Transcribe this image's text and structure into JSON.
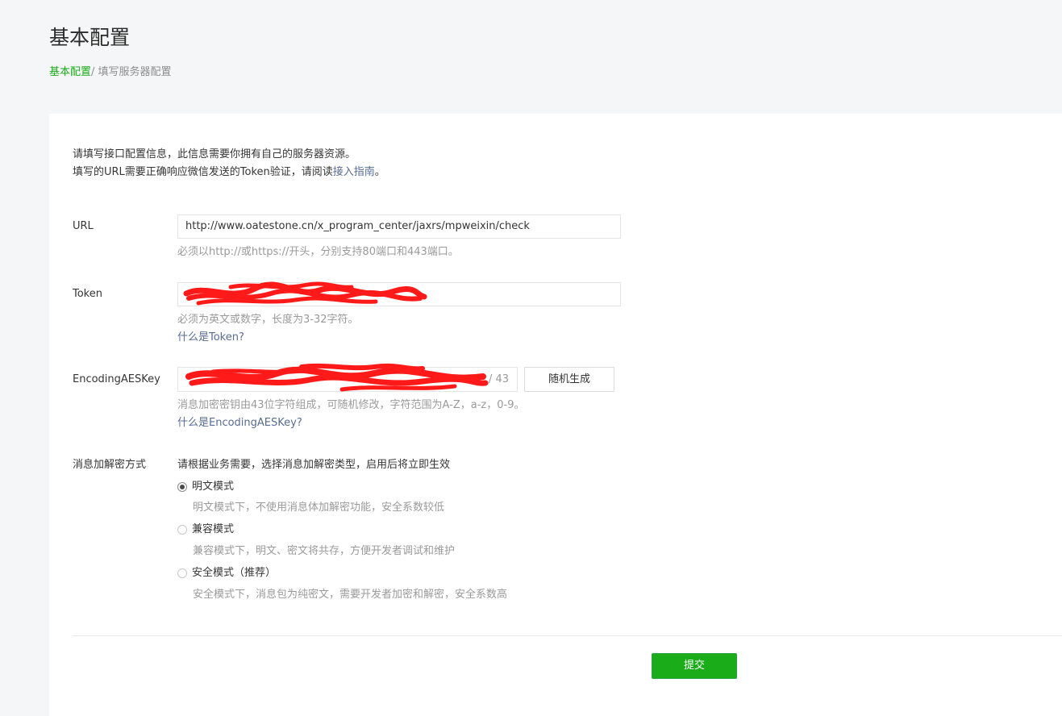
{
  "header": {
    "title": "基本配置",
    "breadcrumb": {
      "link": "基本配置",
      "separator": "/ ",
      "current": "填写服务器配置"
    }
  },
  "intro": {
    "line1": "请填写接口配置信息，此信息需要你拥有自己的服务器资源。",
    "line2_prefix": "填写的URL需要正确响应微信发送的Token验证，请阅读",
    "line2_link": "接入指南",
    "line2_suffix": "。"
  },
  "form": {
    "url": {
      "label": "URL",
      "value": "http://www.oatestone.cn/x_program_center/jaxrs/mpweixin/check",
      "hint": "必须以http://或https://开头，分别支持80端口和443端口。"
    },
    "token": {
      "label": "Token",
      "value": "",
      "hint": "必须为英文或数字，长度为3-32字符。",
      "help_link": "什么是Token?"
    },
    "aes_key": {
      "label": "EncodingAESKey",
      "value": "",
      "counter": "/ 43",
      "generate_button": "随机生成",
      "hint": "消息加密密钥由43位字符组成，可随机修改，字符范围为A-Z，a-z，0-9。",
      "help_link": "什么是EncodingAESKey?"
    },
    "encryption": {
      "label": "消息加解密方式",
      "description": "请根据业务需要，选择消息加解密类型，启用后将立即生效",
      "selected": "plaintext",
      "options": [
        {
          "label": "明文模式",
          "hint": "明文模式下，不使用消息体加解密功能，安全系数较低"
        },
        {
          "label": "兼容模式",
          "hint": "兼容模式下，明文、密文将共存，方便开发者调试和维护"
        },
        {
          "label": "安全模式（推荐）",
          "hint": "安全模式下，消息包为纯密文，需要开发者加密和解密，安全系数高"
        }
      ]
    },
    "submit_button": "提交"
  },
  "colors": {
    "accent_green": "#1aad19",
    "link_blue": "#576b95",
    "redaction_red": "#ff1a1a",
    "page_bg": "#f5f6f7"
  }
}
